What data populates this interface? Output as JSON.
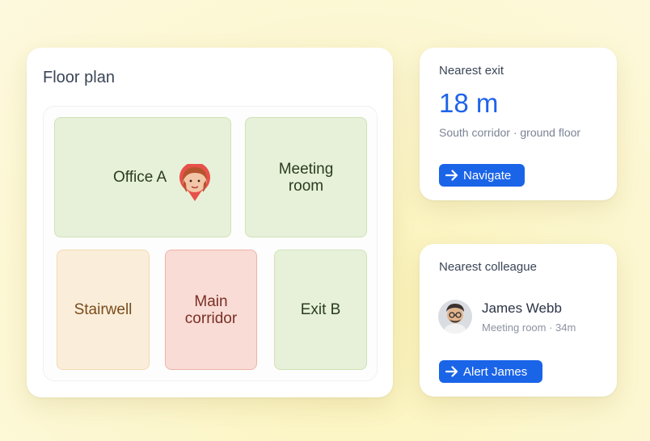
{
  "floor_plan": {
    "title": "Floor plan",
    "rooms": {
      "office_a": "Office A",
      "meeting_room": "Meeting room",
      "stairwell": "Stairwell",
      "main_corridor": "Main corridor",
      "exit_b": "Exit B"
    },
    "user_location_icon": "user-location-pin-icon"
  },
  "nearest_exit": {
    "title": "Nearest exit",
    "distance": "18 m",
    "location": "South corridor · ground floor",
    "button_label": "Navigate",
    "button_icon": "arrow-right-icon"
  },
  "nearest_colleague": {
    "title": "Nearest colleague",
    "name": "James Webb",
    "meta": "Meeting room · 34m",
    "button_label": "Alert James",
    "button_icon": "arrow-right-icon"
  },
  "colors": {
    "accent": "#1a64e8",
    "distance_text": "#1e63e9",
    "room_green": "#e7f0d9",
    "room_orange": "#faeedb",
    "room_red": "#f9dcd6",
    "pin": "#e8514a",
    "background": "#fcf6cc"
  }
}
